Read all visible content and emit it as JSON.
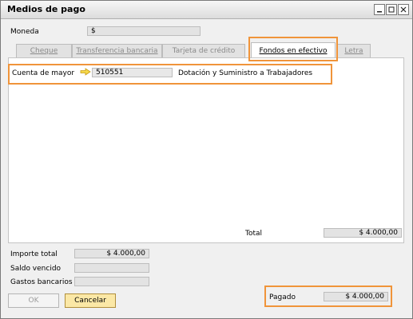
{
  "window": {
    "title": "Medios de pago"
  },
  "currency": {
    "label": "Moneda",
    "value": "$"
  },
  "tabs": [
    {
      "label": "Cheque",
      "active": false
    },
    {
      "label": "Transferencia bancaria",
      "active": false
    },
    {
      "label": "Tarjeta de crédito",
      "active": false
    },
    {
      "label": "Fondos en efectivo",
      "active": true
    },
    {
      "label": "Letra",
      "active": false
    }
  ],
  "cash": {
    "account_label": "Cuenta de mayor",
    "account_code": "510551",
    "account_name": "Dotación y Suministro a Trabajadores",
    "total_label": "Total",
    "total_value": "$ 4.000,00"
  },
  "summary": {
    "importe_total_label": "Importe total",
    "importe_total_value": "$ 4.000,00",
    "saldo_vencido_label": "Saldo vencido",
    "saldo_vencido_value": "",
    "gastos_bancarios_label": "Gastos bancarios",
    "gastos_bancarios_value": "",
    "pagado_label": "Pagado",
    "pagado_value": "$ 4.000,00"
  },
  "buttons": {
    "ok": "OK",
    "cancel": "Cancelar"
  },
  "colors": {
    "highlight": "#f0943a",
    "cancel_bg": "#fbe8a6"
  }
}
